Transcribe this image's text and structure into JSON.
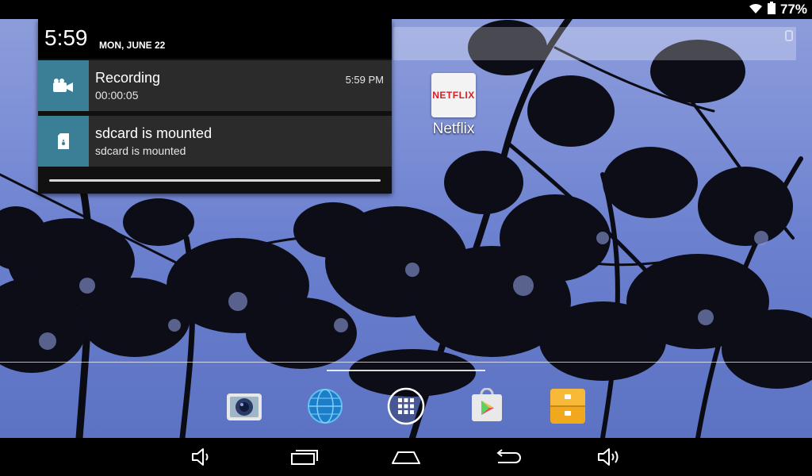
{
  "status_bar": {
    "battery_percent": "77%",
    "icons": [
      "wifi-icon",
      "battery-icon"
    ]
  },
  "notification_shade": {
    "time": "5:59",
    "date": "MON, JUNE 22",
    "notifications": [
      {
        "icon": "video-camera-icon",
        "title": "Recording",
        "subtitle": "00:00:05",
        "time": "5:59 PM"
      },
      {
        "icon": "sdcard-icon",
        "title": "sdcard is mounted",
        "subtitle": "sdcard is mounted",
        "time": ""
      }
    ]
  },
  "desktop": {
    "apps": [
      {
        "label": "Netflix",
        "logo_text": "NETFLIX",
        "icon": "netflix-icon"
      }
    ]
  },
  "dock": {
    "items": [
      {
        "icon": "camera-icon"
      },
      {
        "icon": "browser-globe-icon"
      },
      {
        "icon": "app-drawer-icon"
      },
      {
        "icon": "play-store-icon"
      },
      {
        "icon": "file-manager-icon"
      }
    ]
  },
  "nav_bar": {
    "buttons": [
      "volume-down-icon",
      "recent-apps-icon",
      "home-icon",
      "back-icon",
      "volume-up-icon"
    ]
  },
  "colors": {
    "notification_icon_bg": "#3a7f95",
    "netflix_red": "#d81f26",
    "shade_bg": "#2b2b2b"
  }
}
